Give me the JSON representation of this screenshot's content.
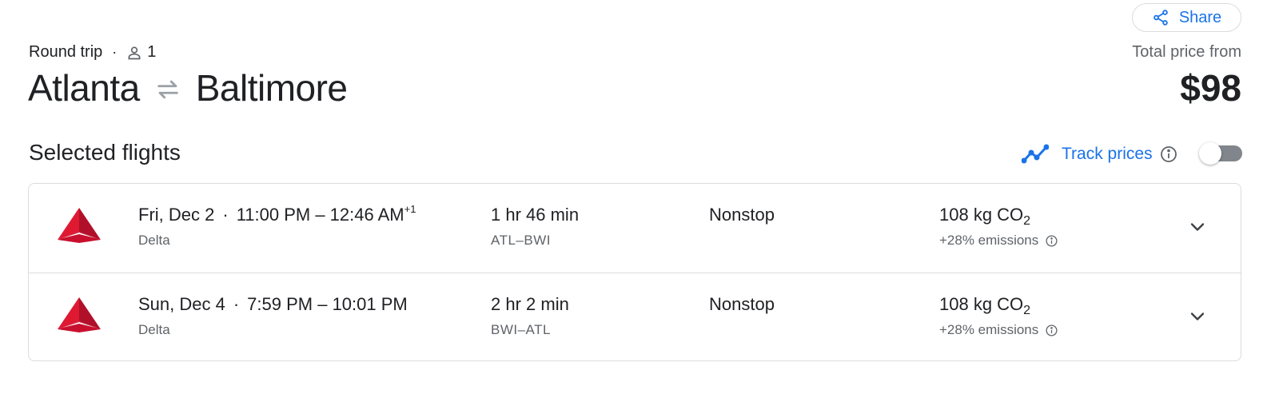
{
  "header": {
    "share_label": "Share",
    "trip_type": "Round trip",
    "passengers": "1",
    "origin": "Atlanta",
    "destination": "Baltimore",
    "price_label": "Total price from",
    "price": "$98"
  },
  "selected": {
    "title": "Selected flights",
    "track_label": "Track prices",
    "track_enabled": false
  },
  "flights": [
    {
      "date": "Fri, Dec 2",
      "times": "11:00 PM – 12:46 AM",
      "day_offset": "+1",
      "airline": "Delta",
      "duration": "1 hr 46 min",
      "route": "ATL–BWI",
      "stops": "Nonstop",
      "co2_value": "108 kg CO",
      "co2_sub": "2",
      "emissions": "+28% emissions"
    },
    {
      "date": "Sun, Dec 4",
      "times": "7:59 PM – 10:01 PM",
      "day_offset": "",
      "airline": "Delta",
      "duration": "2 hr 2 min",
      "route": "BWI–ATL",
      "stops": "Nonstop",
      "co2_value": "108 kg CO",
      "co2_sub": "2",
      "emissions": "+28% emissions"
    }
  ],
  "colors": {
    "accent": "#1a73e8",
    "airline_logo": "#e01933"
  }
}
